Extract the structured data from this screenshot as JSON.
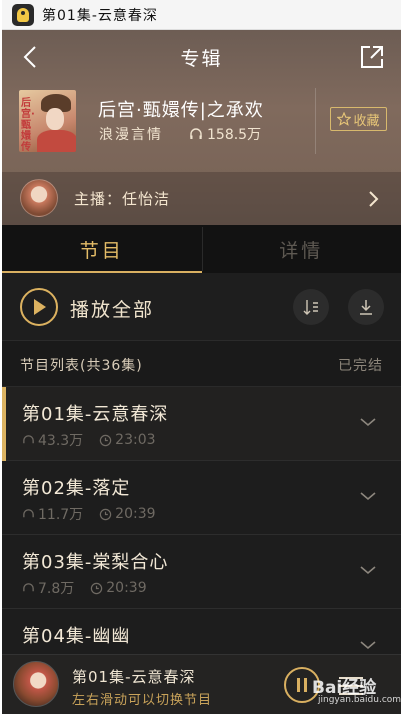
{
  "window": {
    "title": "第01集-云意春深"
  },
  "nav": {
    "title": "专辑"
  },
  "album": {
    "cover_text": "后宫·甄嬛传",
    "title": "后宫·甄嬛传|之承欢",
    "category": "浪漫言情",
    "plays": "158.5万",
    "favorite_label": "收藏"
  },
  "host": {
    "label": "主播：任怡洁"
  },
  "tabs": [
    {
      "label": "节目"
    },
    {
      "label": "详情"
    }
  ],
  "actions": {
    "play_all_label": "播放全部"
  },
  "list": {
    "count_label": "节目列表(共36集)",
    "status_label": "已完结",
    "episodes": [
      {
        "title": "第01集-云意春深",
        "plays": "43.3万",
        "duration": "23:03"
      },
      {
        "title": "第02集-落定",
        "plays": "11.7万",
        "duration": "20:39"
      },
      {
        "title": "第03集-棠梨合心",
        "plays": "7.8万",
        "duration": "20:39"
      },
      {
        "title": "第04集-幽幽",
        "plays": "",
        "duration": ""
      }
    ]
  },
  "player": {
    "title": "第01集-云意春深",
    "hint": "左右滑动可以切换节目"
  },
  "watermark": {
    "brand": "Bai经验",
    "url": "jingyan.baidu.com"
  },
  "colors": {
    "accent": "#dbb362",
    "header_bg": "#806a5d",
    "list_bg": "#1d1d1d"
  },
  "icons": [
    "app-icon",
    "back-icon",
    "share-icon",
    "star-icon",
    "headphones-icon",
    "chevron-right-icon",
    "play-icon",
    "sort-icon",
    "download-icon",
    "clock-icon",
    "chevron-down-icon",
    "pause-icon",
    "playlist-icon"
  ]
}
